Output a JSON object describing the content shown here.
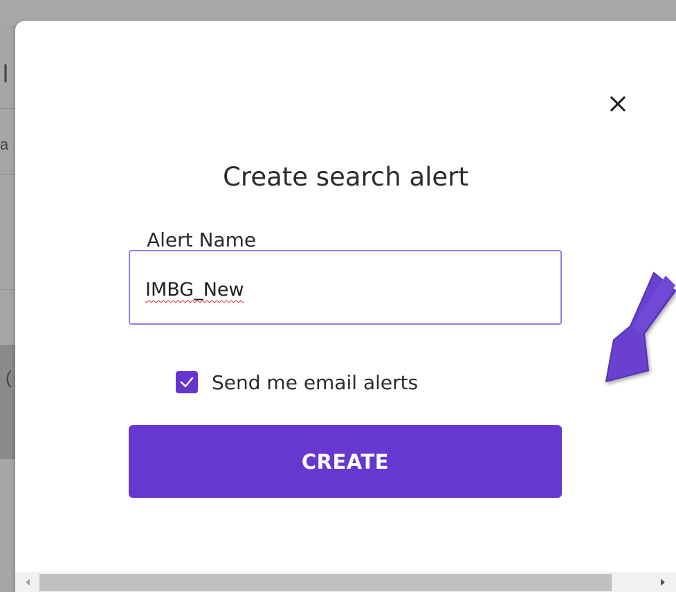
{
  "dialog": {
    "title": "Create search alert",
    "alert_name_label": "Alert Name",
    "alert_name_value": "IMBG_New",
    "email_checkbox_label": "Send me email alerts",
    "email_checkbox_checked": true,
    "create_button_label": "CREATE",
    "close_icon": "close-icon"
  },
  "background": {
    "partial_chars": [
      "l",
      "a",
      "("
    ]
  },
  "colors": {
    "accent": "#6638cf",
    "input_border": "#9a7ae0",
    "annotation_arrow": "#6a3fcf",
    "overlay": "#a7a7a7"
  }
}
